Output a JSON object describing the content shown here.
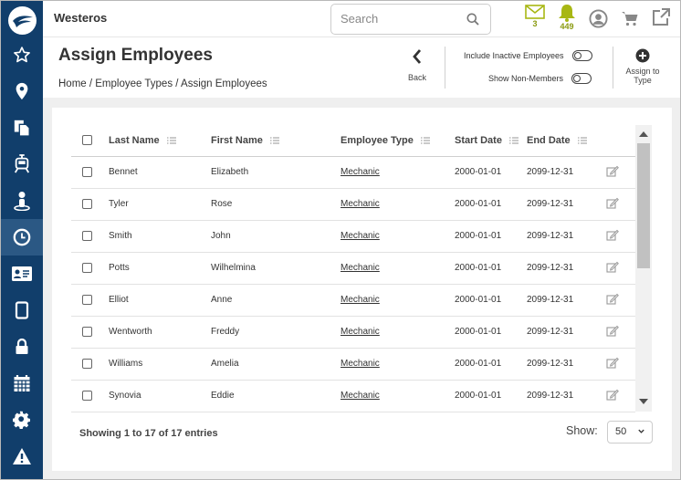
{
  "app": {
    "title": "Westeros"
  },
  "search": {
    "placeholder": "Search"
  },
  "header_icons": {
    "messages_count": "3",
    "notifications_count": "449"
  },
  "page": {
    "title": "Assign Employees",
    "breadcrumb": "Home / Employee Types / Assign Employees",
    "back_label": "Back",
    "include_inactive_label": "Include Inactive Employees",
    "show_non_members_label": "Show Non-Members",
    "assign_label": "Assign to Type"
  },
  "table": {
    "columns": [
      "Last Name",
      "First Name",
      "Employee Type",
      "Start Date",
      "End Date"
    ],
    "rows": [
      {
        "last": "Bennet",
        "first": "Elizabeth",
        "type": "Mechanic",
        "start": "2000-01-01",
        "end": "2099-12-31"
      },
      {
        "last": "Tyler",
        "first": "Rose",
        "type": "Mechanic",
        "start": "2000-01-01",
        "end": "2099-12-31"
      },
      {
        "last": "Smith",
        "first": "John",
        "type": "Mechanic",
        "start": "2000-01-01",
        "end": "2099-12-31"
      },
      {
        "last": "Potts",
        "first": "Wilhelmina",
        "type": "Mechanic",
        "start": "2000-01-01",
        "end": "2099-12-31"
      },
      {
        "last": "Elliot",
        "first": "Anne",
        "type": "Mechanic",
        "start": "2000-01-01",
        "end": "2099-12-31"
      },
      {
        "last": "Wentworth",
        "first": "Freddy",
        "type": "Mechanic",
        "start": "2000-01-01",
        "end": "2099-12-31"
      },
      {
        "last": "Williams",
        "first": "Amelia",
        "type": "Mechanic",
        "start": "2000-01-01",
        "end": "2099-12-31"
      },
      {
        "last": "Synovia",
        "first": "Eddie",
        "type": "Mechanic",
        "start": "2000-01-01",
        "end": "2099-12-31"
      }
    ]
  },
  "footer": {
    "entries_info": "Showing 1 to 17 of 17 entries",
    "show_label": "Show:",
    "page_size": "50"
  },
  "sidebar": {
    "items": [
      "star-icon",
      "map-pin-icon",
      "documents-icon",
      "train-icon",
      "person-icon",
      "clock-icon",
      "id-card-icon",
      "tablet-icon",
      "lock-icon",
      "calendar-icon",
      "gear-icon",
      "warning-icon"
    ],
    "active": "clock-icon"
  },
  "colors": {
    "sidebar": "#113e6b",
    "sidebar_active": "#2b5884",
    "accent_badge": "#a8b714"
  }
}
